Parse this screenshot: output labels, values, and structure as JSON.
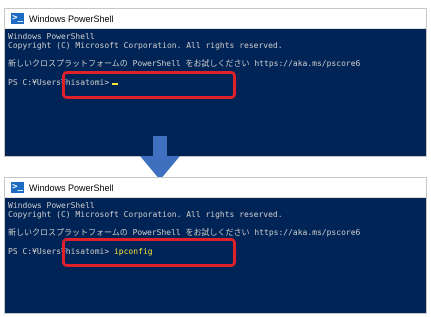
{
  "top_window": {
    "title": "Windows PowerShell",
    "lines": [
      "Windows PowerShell",
      "Copyright (C) Microsoft Corporation. All rights reserved.",
      "新しいクロスプラットフォームの PowerShell をお試しください https://aka.ms/pscore6"
    ],
    "prompt": "PS C:¥Users¥hisatomi>",
    "command": ""
  },
  "bottom_window": {
    "title": "Windows PowerShell",
    "lines": [
      "Windows PowerShell",
      "Copyright (C) Microsoft Corporation. All rights reserved.",
      "新しいクロスプラットフォームの PowerShell をお試しください https://aka.ms/pscore6"
    ],
    "prompt": "PS C:¥Users¥hisatomi>",
    "command": "ipconfig"
  },
  "colors": {
    "console_bg": "#012456",
    "console_text": "#cccccc",
    "command_text": "#f5e43a",
    "highlight": "#e0202a",
    "arrow": "#3f6fbf"
  }
}
